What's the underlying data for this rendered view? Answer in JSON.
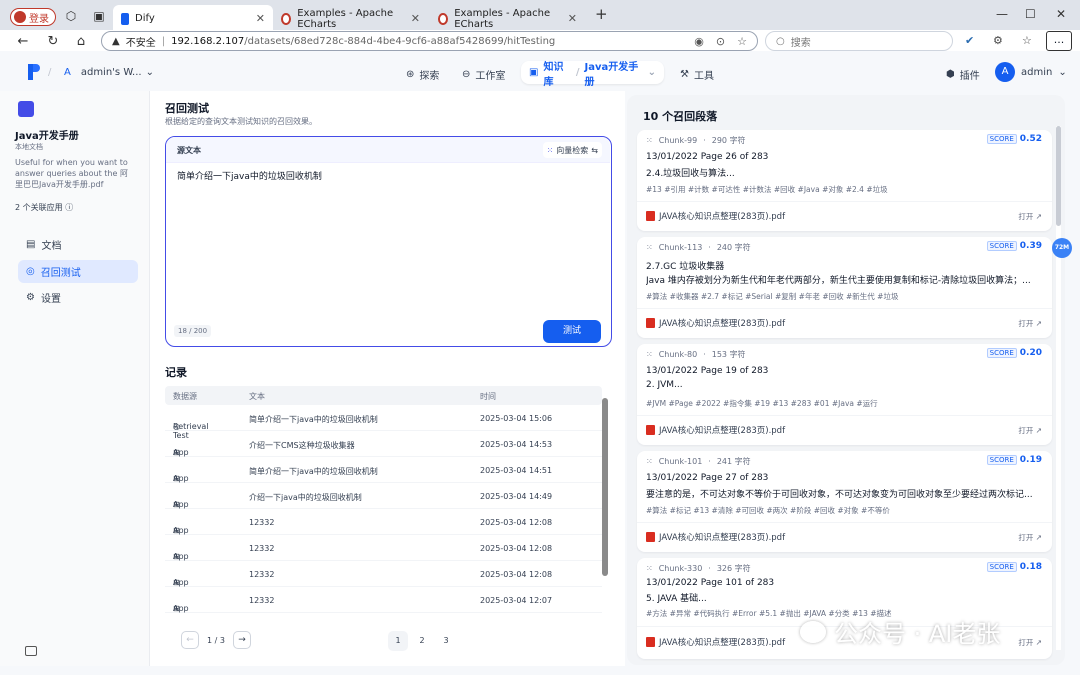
{
  "browser": {
    "profile_label": "登录",
    "tabs": [
      {
        "title": "Dify",
        "color": "#155eef"
      },
      {
        "title": "Examples - Apache ECharts",
        "color": "#c0392b"
      },
      {
        "title": "Examples - Apache ECharts",
        "color": "#c0392b"
      }
    ],
    "new_tab": "+",
    "security_label": "不安全",
    "url_host": "192.168.2.107",
    "url_path": "/datasets/68ed728c-884d-4be4-9cf6-a88af5428699/hitTesting",
    "search_placeholder": "搜索",
    "more": "..."
  },
  "header": {
    "workspace": "admin's W...",
    "workspace_initial": "A",
    "nav_explore": "探索",
    "nav_studio": "工作室",
    "nav_knowledge": "知识库",
    "nav_knowledge_current": "Java开发手册",
    "nav_tools": "工具",
    "plugins": "插件",
    "user_initial": "A",
    "user_name": "admin"
  },
  "sidebar": {
    "dataset_name": "Java开发手册",
    "dataset_type": "本地文档",
    "dataset_desc": "Useful for when you want to answer queries about the 阿里巴巴Java开发手册.pdf",
    "linked_apps": "2 个关联应用",
    "items": [
      {
        "label": "文档"
      },
      {
        "label": "召回测试"
      },
      {
        "label": "设置"
      }
    ]
  },
  "test": {
    "title": "召回测试",
    "subtitle": "根据给定的查询文本测试知识的召回效果。",
    "source_label": "源文本",
    "mode": "向量检索",
    "query": "简单介绍一下java中的垃圾回收机制",
    "count": "18 / 200",
    "button": "测试"
  },
  "records": {
    "title": "记录",
    "headers": [
      "数据源",
      "文本",
      "时间"
    ],
    "rows": [
      {
        "source": "Retrieval Test",
        "text": "简单介绍一下java中的垃圾回收机制",
        "time": "2025-03-04 15:06"
      },
      {
        "source": "App",
        "text": "介绍一下CMS这种垃圾收集器",
        "time": "2025-03-04 14:53"
      },
      {
        "source": "App",
        "text": "简单介绍一下java中的垃圾回收机制",
        "time": "2025-03-04 14:51"
      },
      {
        "source": "App",
        "text": "介绍一下java中的垃圾回收机制",
        "time": "2025-03-04 14:49"
      },
      {
        "source": "App",
        "text": "12332",
        "time": "2025-03-04 12:08"
      },
      {
        "source": "App",
        "text": "12332",
        "time": "2025-03-04 12:08"
      },
      {
        "source": "App",
        "text": "12332",
        "time": "2025-03-04 12:08"
      },
      {
        "source": "App",
        "text": "12332",
        "time": "2025-03-04 12:07"
      }
    ],
    "page_indicator": "1 / 3",
    "pages": [
      "1",
      "2",
      "3"
    ]
  },
  "results": {
    "title": "10 个召回段落",
    "score_label": "SCORE",
    "open_label": "打开",
    "badge": "72M",
    "cards": [
      {
        "chunk": "Chunk-99",
        "chars": "290 字符",
        "score": "0.52",
        "line1": "13/01/2022 Page 26 of 283",
        "line2": "2.4.垃圾回收与算法...",
        "tags": "#13 #引用 #计数 #可达性 #计数法 #回收 #Java #对象 #2.4 #垃圾",
        "file": "JAVA核心知识点整理(283页).pdf"
      },
      {
        "chunk": "Chunk-113",
        "chars": "240 字符",
        "score": "0.39",
        "line1": "2.7.GC 垃圾收集器",
        "line2": "Java 堆内存被划分为新生代和年老代两部分，新生代主要使用复制和标记-清除垃圾回收算法；...",
        "tags": "#算法 #收集器 #2.7 #标记 #Serial #复制 #年老 #回收 #新生代 #垃圾",
        "file": "JAVA核心知识点整理(283页).pdf"
      },
      {
        "chunk": "Chunk-80",
        "chars": "153 字符",
        "score": "0.20",
        "line1": "13/01/2022 Page 19 of 283",
        "line2": "2. JVM...",
        "tags": "#JVM #Page #2022 #指令集 #19 #13 #283 #01 #Java #运行",
        "file": "JAVA核心知识点整理(283页).pdf"
      },
      {
        "chunk": "Chunk-101",
        "chars": "241 字符",
        "score": "0.19",
        "line1": "13/01/2022 Page 27 of 283",
        "line2": "要注意的是，不可达对象不等价于可回收对象，不可达对象变为可回收对象至少要经过两次标记...",
        "tags": "#算法 #标记 #13 #清除 #可回收 #两次 #阶段 #回收 #对象 #不等价",
        "file": "JAVA核心知识点整理(283页).pdf"
      },
      {
        "chunk": "Chunk-330",
        "chars": "326 字符",
        "score": "0.18",
        "line1": "13/01/2022 Page 101 of 283",
        "line2": "5. JAVA 基础...",
        "tags": "#方法 #异常 #代码执行 #Error #5.1 #抛出 #JAVA #分类 #13 #描述",
        "file": "JAVA核心知识点整理(283页).pdf"
      }
    ]
  },
  "watermark": "公众号 · AI老张"
}
